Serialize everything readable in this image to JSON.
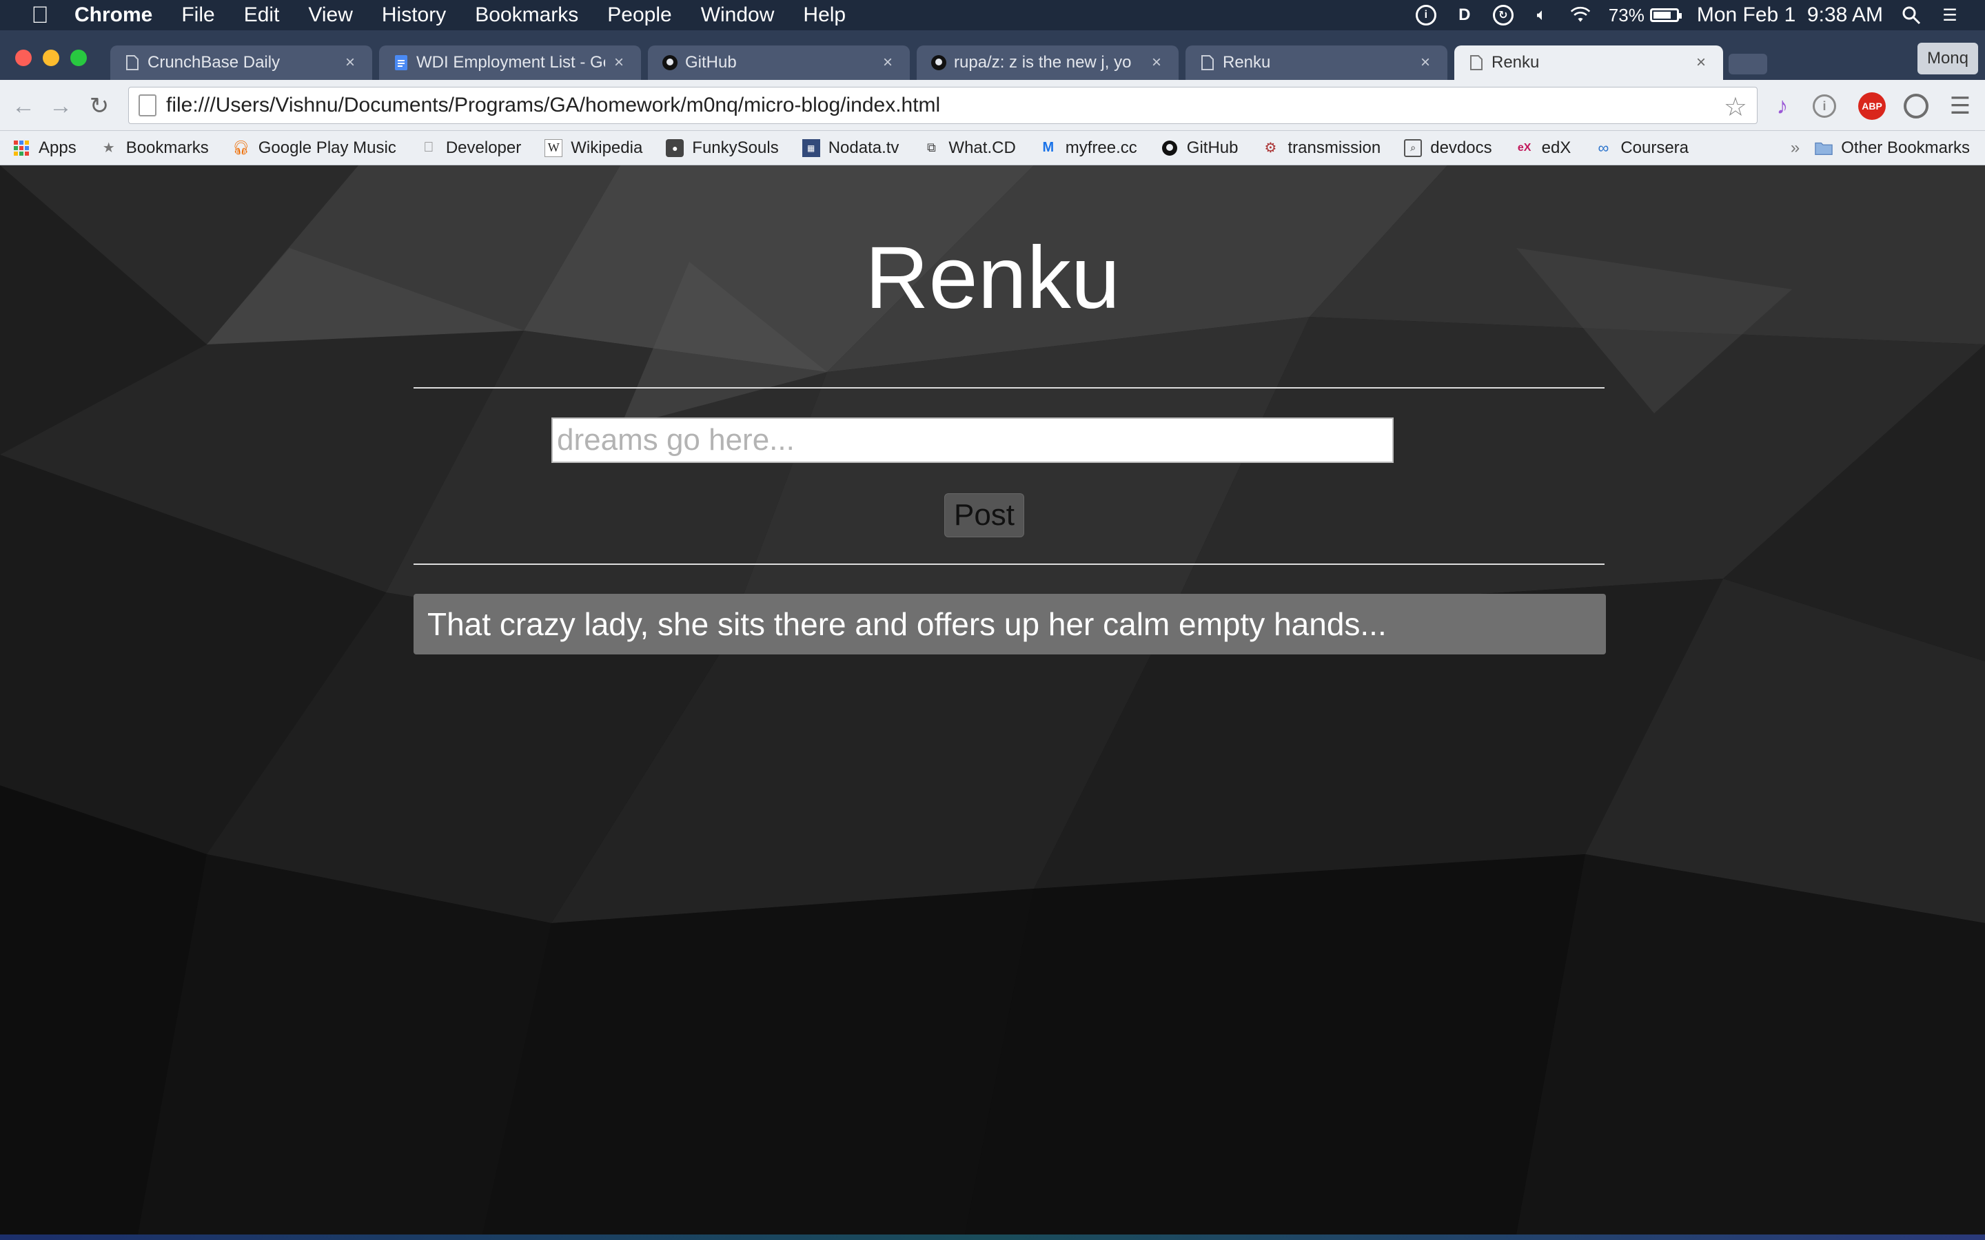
{
  "menubar": {
    "app_name": "Chrome",
    "items": [
      "File",
      "Edit",
      "View",
      "History",
      "Bookmarks",
      "People",
      "Window",
      "Help"
    ],
    "battery_percent": "73%",
    "battery_level": 0.73,
    "datetime": "Mon Feb 1  9:38 AM"
  },
  "tabs": [
    {
      "title": "CrunchBase Daily",
      "icon": "page-icon",
      "active": false
    },
    {
      "title": "WDI Employment List - Goo",
      "icon": "google-docs-icon",
      "active": false
    },
    {
      "title": "GitHub",
      "icon": "github-icon",
      "active": false
    },
    {
      "title": "rupa/z: z is the new j, yo",
      "icon": "github-icon",
      "active": false
    },
    {
      "title": "Renku",
      "icon": "page-icon",
      "active": false
    },
    {
      "title": "Renku",
      "icon": "page-icon",
      "active": true
    }
  ],
  "profile_name": "Monq",
  "address_bar": {
    "url": "file:///Users/Vishnu/Documents/Programs/GA/homework/m0nq/micro-blog/index.html"
  },
  "extensions": [
    {
      "name": "music-icon",
      "label": "♪",
      "color": "#9b59d6"
    },
    {
      "name": "info-icon",
      "label": "i",
      "color": "#8a8a8a"
    },
    {
      "name": "adblock-plus-icon",
      "label": "ABP",
      "color": "#d9261c"
    },
    {
      "name": "record-icon",
      "label": "●",
      "color": "#6e6e6e"
    }
  ],
  "bookmarks": [
    {
      "label": "Apps",
      "icon": "apps-grid-icon"
    },
    {
      "label": "Bookmarks",
      "icon": "star-icon"
    },
    {
      "label": "Google Play Music",
      "icon": "headphones-icon"
    },
    {
      "label": "Developer",
      "icon": "apple-icon"
    },
    {
      "label": "Wikipedia",
      "icon": "wikipedia-icon"
    },
    {
      "label": "FunkySouls",
      "icon": "funkysouls-icon"
    },
    {
      "label": "Nodata.tv",
      "icon": "nodata-icon"
    },
    {
      "label": "What.CD",
      "icon": "whatcd-icon"
    },
    {
      "label": "myfree.cc",
      "icon": "myfree-icon"
    },
    {
      "label": "GitHub",
      "icon": "github-icon"
    },
    {
      "label": "transmission",
      "icon": "transmission-icon"
    },
    {
      "label": "devdocs",
      "icon": "devdocs-icon"
    },
    {
      "label": "edX",
      "icon": "edx-icon"
    },
    {
      "label": "Coursera",
      "icon": "coursera-icon"
    }
  ],
  "bookmarks_overflow": "»",
  "other_bookmarks": "Other Bookmarks",
  "page": {
    "title": "Renku",
    "input_placeholder": "dreams go here...",
    "post_button": "Post",
    "posts": [
      "That crazy lady, she sits there and offers up her calm empty hands..."
    ]
  }
}
